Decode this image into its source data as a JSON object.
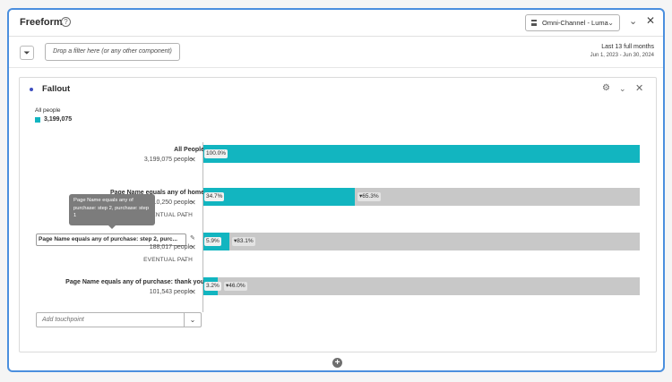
{
  "header": {
    "title": "Freeform",
    "help_icon": "?",
    "report_suite": "Omni-Channel - Luma",
    "close_icon": "✕",
    "collapse_icon": "⌄"
  },
  "filterbar": {
    "drop_placeholder": "Drop a filter here (or any other component)",
    "date_range_label": "Last 13 full months",
    "date_range": "Jun 1, 2023 - Jun 30, 2024"
  },
  "panel": {
    "title": "Fallout",
    "segment": {
      "name": "All people",
      "count": "3,199,075",
      "color": "#12b5c0"
    },
    "touchpoints": [
      {
        "label": "All People",
        "count": "3,199,075 people",
        "pct": "100.0%",
        "pct_value": 100,
        "drop": "",
        "path": ""
      },
      {
        "label": "Page Name equals any of home",
        "count": "1,110,250 people",
        "pct": "34.7%",
        "pct_value": 34.7,
        "drop": "▾65.3%",
        "path": "EVENTUAL PATH"
      },
      {
        "label": "Page Name equals any of purchase: step 2, purc...",
        "count": "188,017 people",
        "pct": "5.9%",
        "pct_value": 5.9,
        "drop": "▾83.1%",
        "path": "EVENTUAL PATH"
      },
      {
        "label": "Page Name equals any of purchase: thank you",
        "count": "101,543 people",
        "pct": "3.2%",
        "pct_value": 3.2,
        "drop": "▾46.0%",
        "path": ""
      }
    ],
    "tooltip": "Page Name equals any of purchase: step 2, purchase: step 1",
    "add_touchpoint_placeholder": "Add touchpoint"
  },
  "colors": {
    "accent": "#12b5c0",
    "border": "#4b8fde",
    "bar_bg": "#c8c8c8"
  }
}
